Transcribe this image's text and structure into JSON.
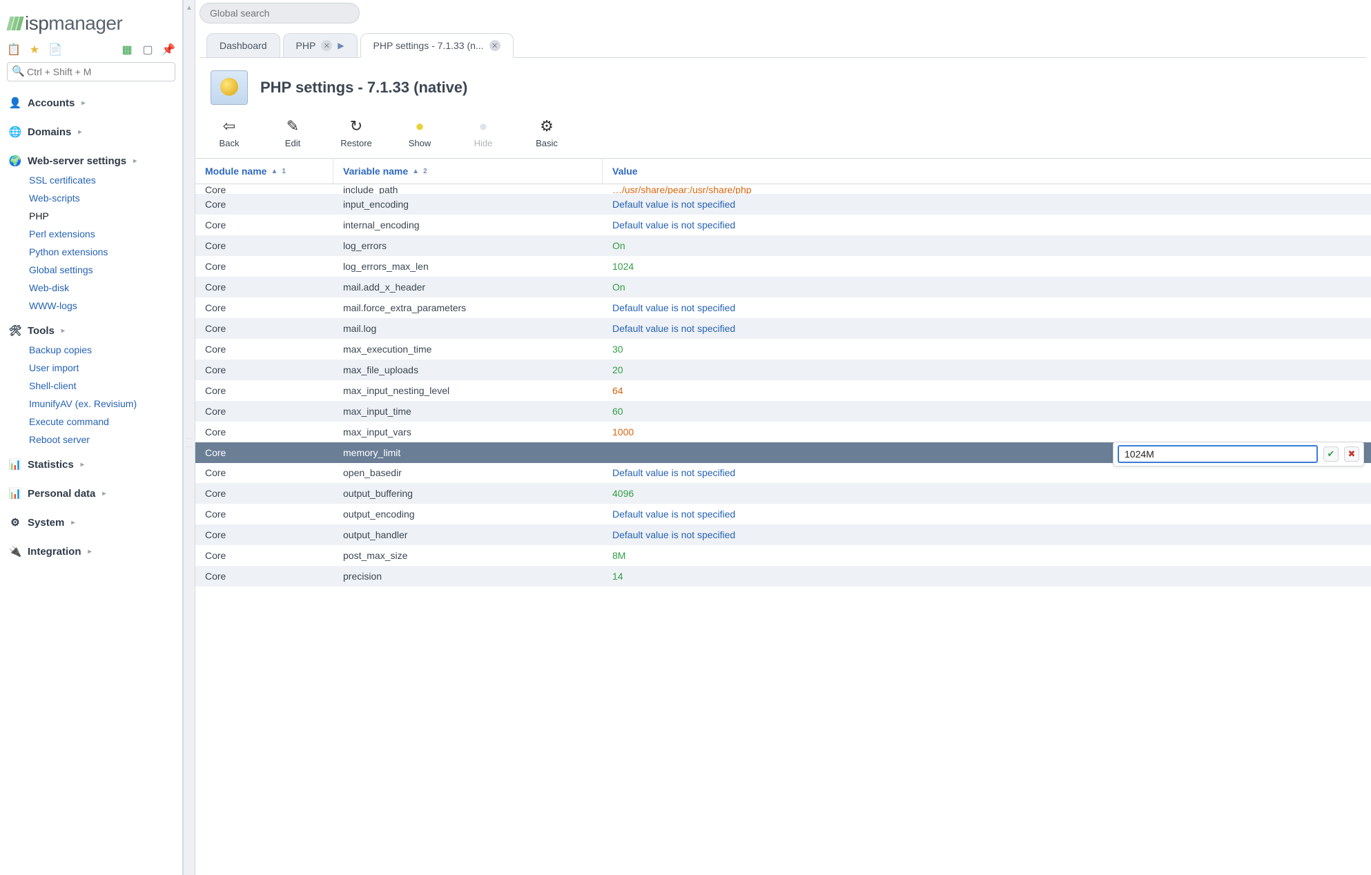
{
  "brand": {
    "name": "ispmanager"
  },
  "global_search_placeholder": "Global search",
  "sidebar": {
    "search_placeholder": "Ctrl + Shift + M",
    "sections": [
      {
        "title": "Accounts",
        "open": false,
        "items": []
      },
      {
        "title": "Domains",
        "open": false,
        "items": []
      },
      {
        "title": "Web-server settings",
        "open": true,
        "items": [
          {
            "label": "SSL certificates",
            "active": false
          },
          {
            "label": "Web-scripts",
            "active": false
          },
          {
            "label": "PHP",
            "active": true
          },
          {
            "label": "Perl extensions",
            "active": false
          },
          {
            "label": "Python extensions",
            "active": false
          },
          {
            "label": "Global settings",
            "active": false
          },
          {
            "label": "Web-disk",
            "active": false
          },
          {
            "label": "WWW-logs",
            "active": false
          }
        ]
      },
      {
        "title": "Tools",
        "open": true,
        "items": [
          {
            "label": "Backup copies",
            "active": false
          },
          {
            "label": "User import",
            "active": false
          },
          {
            "label": "Shell-client",
            "active": false
          },
          {
            "label": "ImunifyAV (ex. Revisium)",
            "active": false
          },
          {
            "label": "Execute command",
            "active": false
          },
          {
            "label": "Reboot server",
            "active": false
          }
        ]
      },
      {
        "title": "Statistics",
        "open": false,
        "items": []
      },
      {
        "title": "Personal data",
        "open": false,
        "items": []
      },
      {
        "title": "System",
        "open": false,
        "items": []
      },
      {
        "title": "Integration",
        "open": false,
        "items": []
      }
    ]
  },
  "tabs": [
    {
      "label": "Dashboard",
      "closable": false,
      "active": false,
      "crumb": false
    },
    {
      "label": "PHP",
      "closable": true,
      "active": false,
      "crumb": true
    },
    {
      "label": "PHP settings - 7.1.33 (n...",
      "closable": true,
      "active": true,
      "crumb": false
    }
  ],
  "page": {
    "title": "PHP settings - 7.1.33 (native)",
    "toolbar": [
      {
        "label": "Back",
        "disabled": false,
        "glyph": "⇦",
        "name": "back"
      },
      {
        "label": "Edit",
        "disabled": false,
        "glyph": "✎",
        "name": "edit"
      },
      {
        "label": "Restore",
        "disabled": false,
        "glyph": "↻",
        "name": "restore"
      },
      {
        "label": "Show",
        "disabled": false,
        "glyph": "●",
        "color": "#e8d33a",
        "name": "show"
      },
      {
        "label": "Hide",
        "disabled": true,
        "glyph": "●",
        "color": "#aebccc",
        "name": "hide"
      },
      {
        "label": "Basic",
        "disabled": false,
        "glyph": "⚙",
        "name": "basic"
      }
    ],
    "columns": [
      {
        "label": "Module name",
        "sort_order": 1
      },
      {
        "label": "Variable name",
        "sort_order": 2
      },
      {
        "label": "Value",
        "sort_order": null
      }
    ],
    "editing": {
      "row_index": 13,
      "input_value": "1024M"
    },
    "rows": [
      {
        "module": "Core",
        "variable": "include_path",
        "value": "…/usr/share/pear:/usr/share/php",
        "vclass": "orange",
        "cutoff": true
      },
      {
        "module": "Core",
        "variable": "input_encoding",
        "value": "Default value is not specified",
        "vclass": "blue"
      },
      {
        "module": "Core",
        "variable": "internal_encoding",
        "value": "Default value is not specified",
        "vclass": "blue"
      },
      {
        "module": "Core",
        "variable": "log_errors",
        "value": "On",
        "vclass": "green"
      },
      {
        "module": "Core",
        "variable": "log_errors_max_len",
        "value": "1024",
        "vclass": "green"
      },
      {
        "module": "Core",
        "variable": "mail.add_x_header",
        "value": "On",
        "vclass": "green"
      },
      {
        "module": "Core",
        "variable": "mail.force_extra_parameters",
        "value": "Default value is not specified",
        "vclass": "blue"
      },
      {
        "module": "Core",
        "variable": "mail.log",
        "value": "Default value is not specified",
        "vclass": "blue"
      },
      {
        "module": "Core",
        "variable": "max_execution_time",
        "value": "30",
        "vclass": "green"
      },
      {
        "module": "Core",
        "variable": "max_file_uploads",
        "value": "20",
        "vclass": "green"
      },
      {
        "module": "Core",
        "variable": "max_input_nesting_level",
        "value": "64",
        "vclass": "orange"
      },
      {
        "module": "Core",
        "variable": "max_input_time",
        "value": "60",
        "vclass": "green"
      },
      {
        "module": "Core",
        "variable": "max_input_vars",
        "value": "1000",
        "vclass": "orange"
      },
      {
        "module": "Core",
        "variable": "memory_limit",
        "value": "",
        "vclass": "",
        "selected": true
      },
      {
        "module": "Core",
        "variable": "open_basedir",
        "value": "Default value is not specified",
        "vclass": "blue"
      },
      {
        "module": "Core",
        "variable": "output_buffering",
        "value": "4096",
        "vclass": "green"
      },
      {
        "module": "Core",
        "variable": "output_encoding",
        "value": "Default value is not specified",
        "vclass": "blue"
      },
      {
        "module": "Core",
        "variable": "output_handler",
        "value": "Default value is not specified",
        "vclass": "blue"
      },
      {
        "module": "Core",
        "variable": "post_max_size",
        "value": "8M",
        "vclass": "green"
      },
      {
        "module": "Core",
        "variable": "precision",
        "value": "14",
        "vclass": "green"
      }
    ]
  }
}
